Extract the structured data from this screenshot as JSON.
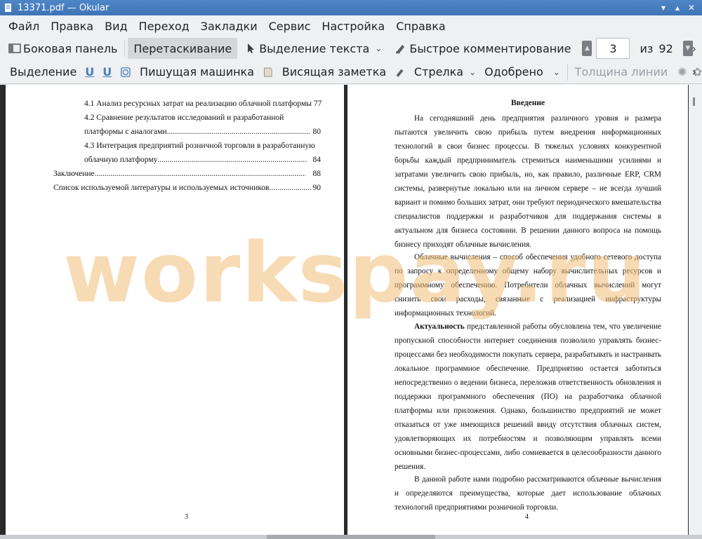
{
  "window": {
    "title": "13371.pdf — Okular"
  },
  "menubar": {
    "items": [
      "Файл",
      "Правка",
      "Вид",
      "Переход",
      "Закладки",
      "Сервис",
      "Настройка",
      "Справка"
    ]
  },
  "toolbar1": {
    "sidebar": "Боковая панель",
    "drag": "Перетаскивание",
    "text_select": "Выделение текста",
    "quick_comment": "Быстрое комментирование",
    "page_current": "3",
    "page_of": "из",
    "page_total": "92"
  },
  "toolbar2": {
    "selection": "Выделение",
    "typewriter": "Пишущая машинка",
    "pinned_note": "Висящая заметка",
    "arrow": "Стрелка",
    "approved": "Одобрено",
    "line_width": "Толщина линии"
  },
  "left_page": {
    "toc": [
      {
        "text": "4.1 Анализ ресурсных затрат на реализацию облачной платформы 77"
      },
      {
        "text": "4.2 Сравнение результатов исследований и разработанной"
      },
      {
        "text": "платформы с аналогами",
        "page": "80"
      },
      {
        "text": "4.3 Интеграция предприятий розничной торговли в разработанную"
      },
      {
        "text": "облачную платформу",
        "page": "84"
      },
      {
        "text": "Заключение",
        "page": "88"
      },
      {
        "text": "Список используемой литературы и используемых источников",
        "page": "90"
      }
    ],
    "page_number": "3"
  },
  "right_page": {
    "heading": "Введение",
    "p1": "На сегодняшний день предприятия различного уровня и размера пытаются увеличить свою прибыль путем внедрения информационных технологий в свои бизнес процессы. В тяжелых условиях конкурентной борьбы каждый предприниматель стремиться наименьшими усилиями и затратами увеличить свою прибыль, но, как правило, различные ERP, CRM системы, развернутые локально или на личном сервере – не всегда лучший вариант и помимо больших затрат, они требуют периодического вмешательства специалистов поддержки и разработчиков для поддержания системы в актуальном для бизнеса состоянии. В решении данного вопроса на помощь бизнесу приходят облачные вычисления.",
    "p2": "Облачные вычисления – способ обеспечения удобного сетевого доступа по запросу к определенному общему набору вычислительных ресурсов и программному обеспечению. Потребители облачных вычислений могут снизить свои расходы, связанные с реализацией инфраструктуры информационных технологий.",
    "p3_bold": "Актуальность",
    "p3": " представленной работы обусловлена тем, что увеличение пропускной способности интернет соединения позволило управлять бизнес-процессами без необходимости покупать сервера, разрабатывать и настраивать локальное программное обеспечение. Предприятию остается заботиться непосредственно о ведении бизнеса, переложив ответственность обновления и поддержки программного обеспечения (ПО) на разработчика облачной платформы или приложения. Однако, большинство предприятий не может отказаться от уже имеющихся решений ввиду отсутствия облачных систем, удовлетворяющих их потребностям и позволяющим управлять всеми основными бизнес-процессами, либо сомневается в целесообразности данного решения.",
    "p4": "В данной работе нами подробно рассматриваются облачные вычисления и определяются преимущества, которые дает использование облачных технологий предприятиями розничной торговли.",
    "page_number": "4"
  },
  "watermark": "workspay.ru"
}
